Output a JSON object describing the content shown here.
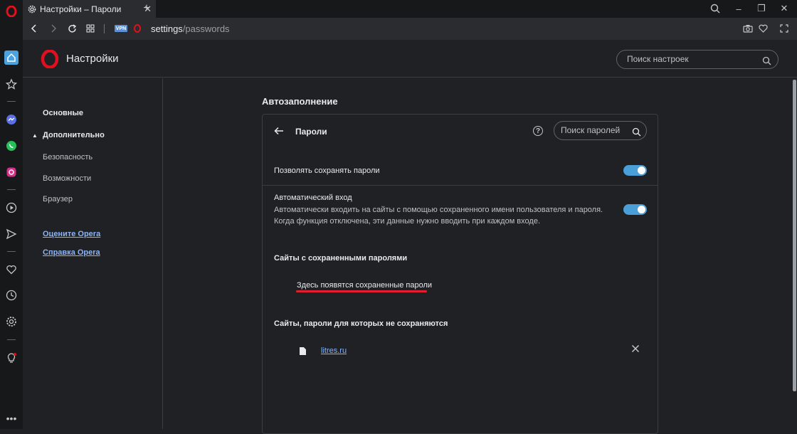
{
  "tab": {
    "title": "Настройки – Пароли",
    "close": "✕",
    "new_tab": "+"
  },
  "window": {
    "search_icon": "search-icon",
    "minimize": "–",
    "restore": "❐",
    "close": "✕"
  },
  "address": {
    "vpn_badge": "VPN",
    "url_prefix": "settings",
    "url_path": "/passwords"
  },
  "header": {
    "title": "Настройки",
    "search_placeholder": "Поиск настроек"
  },
  "leftnav": {
    "items": [
      {
        "label": "Основные"
      },
      {
        "label": "Дополнительно",
        "expanded": true
      },
      {
        "label": "Безопасность"
      },
      {
        "label": "Возможности"
      },
      {
        "label": "Браузер"
      }
    ],
    "links": [
      {
        "label": "Оцените Opera"
      },
      {
        "label": "Справка Opera"
      }
    ]
  },
  "content": {
    "section_title": "Автозаполнение",
    "card": {
      "title": "Пароли",
      "search_placeholder": "Поиск паролей",
      "allow_save": {
        "label": "Позволять сохранять пароли",
        "enabled": true
      },
      "auto_signin": {
        "label": "Автоматический вход",
        "desc1": "Автоматически входить на сайты с помощью сохраненного имени пользователя и пароля.",
        "desc2": "Когда функция отключена, эти данные нужно вводить при каждом входе.",
        "enabled": true
      },
      "saved_heading": "Сайты с сохраненными паролями",
      "saved_empty": "Здесь появятся сохраненные пароли",
      "never_heading": "Сайты, пароли для которых не сохраняются",
      "never_sites": [
        {
          "site": "litres.ru"
        }
      ]
    }
  },
  "colors": {
    "accent": "#4a9fd8",
    "brand": "#e0101e",
    "link": "#8ab4f8",
    "annotation": "#e02030"
  }
}
